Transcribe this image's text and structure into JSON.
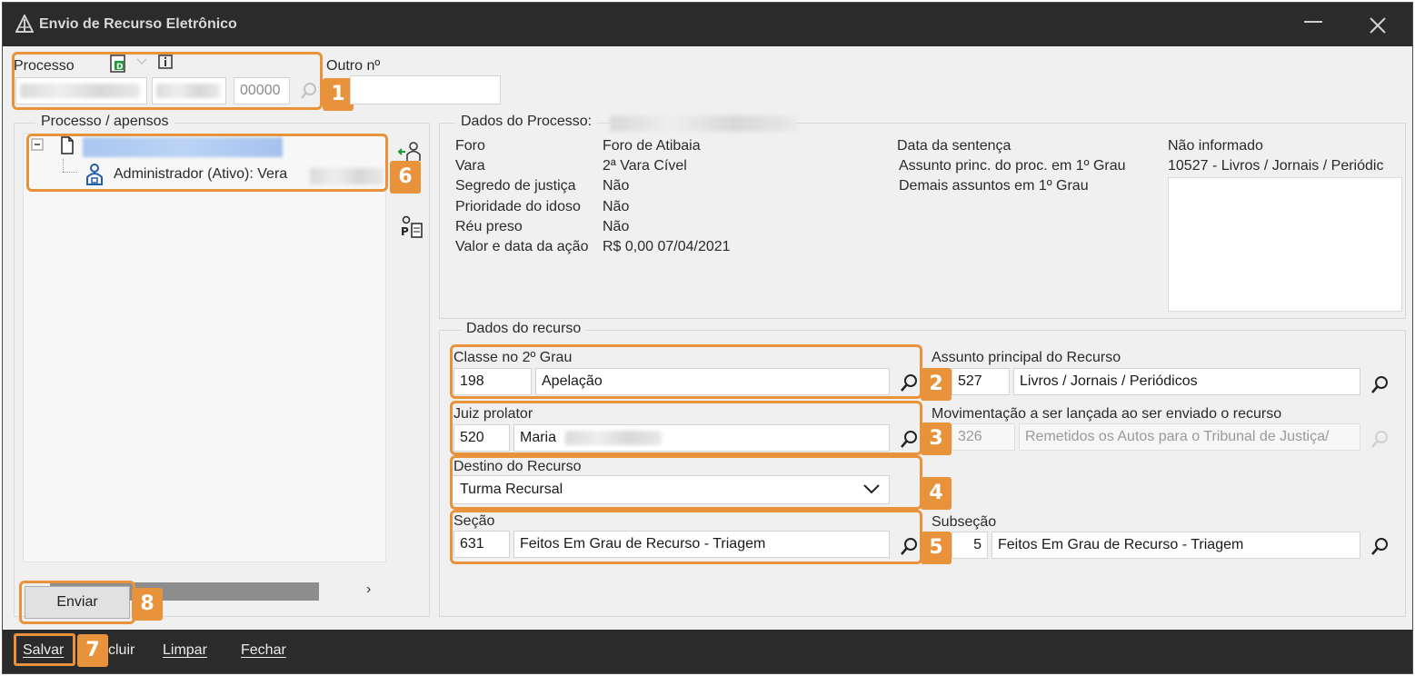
{
  "window": {
    "title": "Envio de Recurso Eletrônico"
  },
  "processo": {
    "label": "Processo",
    "field_3_value": "00000",
    "outro_label": "Outro nº",
    "outro_value": ""
  },
  "apensos": {
    "group_title": "Processo / apensos",
    "admin_label": "Administrador (Ativo): Vera"
  },
  "dados_processo": {
    "group_title": "Dados do Processo:",
    "rows": [
      {
        "label": "Foro",
        "value": "Foro de Atibaia"
      },
      {
        "label": "Vara",
        "value": "2ª Vara Cível"
      },
      {
        "label": "Segredo de justiça",
        "value": "Não"
      },
      {
        "label": "Prioridade do idoso",
        "value": "Não"
      },
      {
        "label": "Réu preso",
        "value": "Não"
      },
      {
        "label": "Valor e data da ação",
        "value": "R$ 0,00 07/04/2021"
      }
    ],
    "data_sentenca_label": "Data da sentença",
    "data_sentenca_value": "Não informado",
    "assunto_label": "Assunto princ. do proc. em 1º Grau",
    "assunto_value": "10527 - Livros / Jornais / Periódic",
    "demais_label": "Demais assuntos em 1º Grau"
  },
  "dados_recurso": {
    "group_title": "Dados do recurso",
    "classe": {
      "label": "Classe no 2º Grau",
      "code": "198",
      "value": "Apelação"
    },
    "assunto": {
      "label": "Assunto principal do Recurso",
      "code": "527",
      "value": "Livros / Jornais / Periódicos"
    },
    "juiz": {
      "label": "Juiz prolator",
      "code": "520",
      "value": "Maria"
    },
    "movimentacao": {
      "label": "Movimentação a ser lançada ao ser enviado o recurso",
      "code": "326",
      "value": "Remetidos os Autos para o Tribunal de Justiça/"
    },
    "destino": {
      "label": "Destino do Recurso",
      "value": "Turma Recursal"
    },
    "secao": {
      "label": "Seção",
      "code": "631",
      "value": "Feitos Em Grau de Recurso - Triagem"
    },
    "subsecao": {
      "label": "Subseção",
      "code": "5",
      "value": "Feitos Em Grau de Recurso - Triagem"
    }
  },
  "buttons": {
    "enviar": "Enviar"
  },
  "toolbar": {
    "salvar": "Salvar",
    "excluir": "cluir",
    "limpar": "Limpar",
    "fechar": "Fechar"
  },
  "badges": {
    "b1": "1",
    "b2": "2",
    "b3": "3",
    "b4": "4",
    "b5": "5",
    "b6": "6",
    "b7": "7",
    "b8": "8"
  },
  "colors": {
    "highlight": "#e8933c",
    "titlebar": "#2b2b2b",
    "tree_selection": "#a9c7f0"
  }
}
